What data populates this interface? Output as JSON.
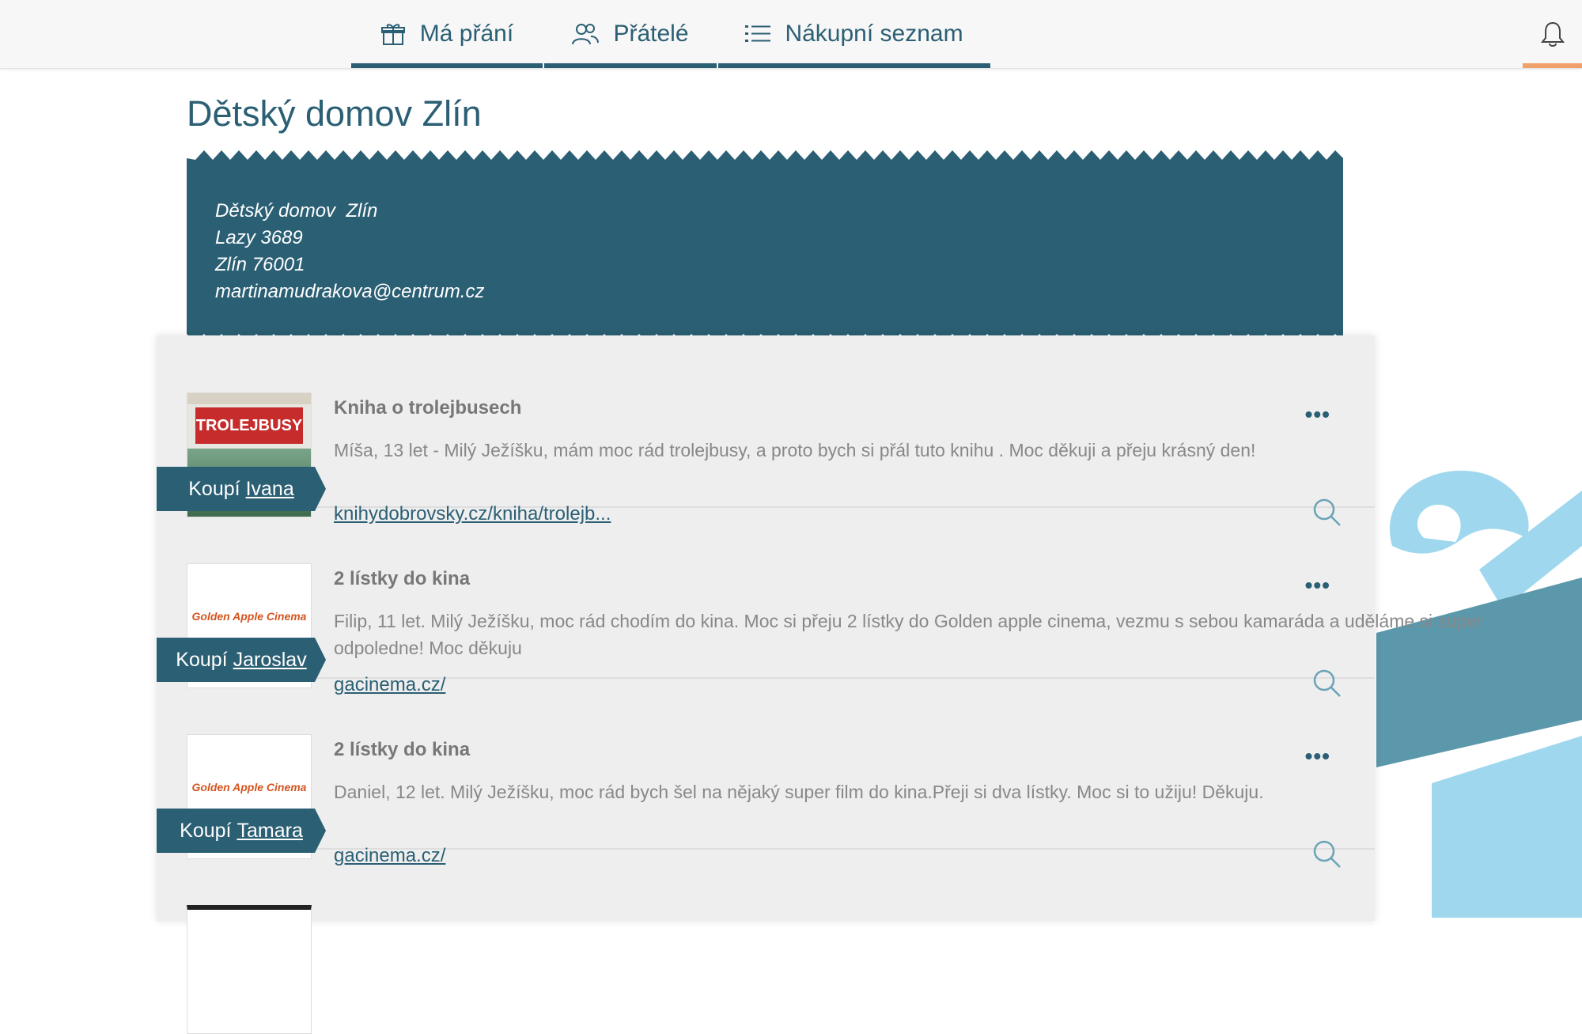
{
  "nav": {
    "tabs": [
      {
        "label": "Má přání",
        "icon": "gift-icon"
      },
      {
        "label": "Přátelé",
        "icon": "friends-icon"
      },
      {
        "label": "Nákupní seznam",
        "icon": "list-icon"
      }
    ],
    "notifications_icon": "bell-icon"
  },
  "page": {
    "title": "Dětský domov Zlín"
  },
  "address": {
    "name": "Dětský domov  Zlín",
    "street": "Lazy 3689",
    "city": "Zlín 76001",
    "email": "martinamudrakova@centrum.cz"
  },
  "wishes": [
    {
      "buyer_prefix": "Koupí",
      "buyer_name": "Ivana",
      "title": "Kniha o trolejbusech",
      "description": "Míša, 13 let - Milý Ježíšku, mám moc rád trolejbusy, a proto bych si přál tuto knihu . Moc děkuji a přeju krásný den!",
      "link": "knihydobrovsky.cz/kniha/trolejb...",
      "thumb_text": "TROLEJBUSY"
    },
    {
      "buyer_prefix": "Koupí",
      "buyer_name": "Jaroslav",
      "title": "2 lístky do kina",
      "description": "Filip, 11 let. Milý Ježíšku, moc rád chodím do kina. Moc si přeju 2 lístky do Golden apple cinema, vezmu s sebou kamaráda a uděláme si super odpoledne! Moc děkuju",
      "link": "gacinema.cz/",
      "thumb_text": "Golden Apple Cinema"
    },
    {
      "buyer_prefix": "Koupí",
      "buyer_name": "Tamara",
      "title": "2 lístky do kina",
      "description": "Daniel, 12 let. Milý Ježíšku, moc rád bych šel na nějaký super film do kina.Přeji si dva lístky. Moc si to užiju! Děkuju.",
      "link": "gacinema.cz/",
      "thumb_text": "Golden Apple Cinema"
    }
  ],
  "more_label": "•••",
  "colors": {
    "primary": "#2b5f74",
    "accent": "#f0a06a",
    "decor": "#9fd8ee"
  }
}
